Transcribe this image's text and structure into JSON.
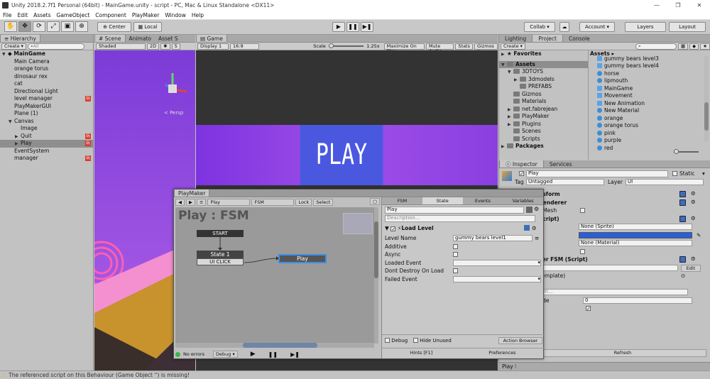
{
  "window": {
    "title": "Unity 2018.2.7f1 Personal (64bit) - MainGame.unity - script - PC, Mac & Linux Standalone <DX11>"
  },
  "menu": [
    "File",
    "Edit",
    "Assets",
    "GameObject",
    "Component",
    "PlayMaker",
    "Window",
    "Help"
  ],
  "toolbar": {
    "center": "Center",
    "local": "Local",
    "collab": "Collab ▾",
    "account": "Account ▾",
    "layers": "Layers",
    "layout": "Layout"
  },
  "hierarchy": {
    "tab": "Hierarchy",
    "create": "Create ▾",
    "search": "All",
    "scene": "MainGame",
    "items": [
      {
        "label": "Main Camera",
        "indent": 1,
        "arrow": "",
        "badge": false,
        "selected": false
      },
      {
        "label": "orange torus",
        "indent": 1,
        "arrow": "",
        "badge": false,
        "selected": false
      },
      {
        "label": "dinosaur rex",
        "indent": 1,
        "arrow": "",
        "badge": false,
        "selected": false
      },
      {
        "label": "cat",
        "indent": 1,
        "arrow": "",
        "badge": false,
        "selected": false
      },
      {
        "label": "Directional Light",
        "indent": 1,
        "arrow": "",
        "badge": false,
        "selected": false
      },
      {
        "label": "level manager",
        "indent": 1,
        "arrow": "",
        "badge": true,
        "selected": false
      },
      {
        "label": "PlayMakerGUI",
        "indent": 1,
        "arrow": "",
        "badge": false,
        "selected": false
      },
      {
        "label": "Plane (1)",
        "indent": 1,
        "arrow": "",
        "badge": false,
        "selected": false
      },
      {
        "label": "Canvas",
        "indent": 1,
        "arrow": "▼",
        "badge": false,
        "selected": false
      },
      {
        "label": "Image",
        "indent": 2,
        "arrow": "",
        "badge": false,
        "selected": false
      },
      {
        "label": "Quit",
        "indent": 2,
        "arrow": "▶",
        "badge": true,
        "selected": false
      },
      {
        "label": "Play",
        "indent": 2,
        "arrow": "▶",
        "badge": true,
        "selected": true
      },
      {
        "label": "EventSystem",
        "indent": 1,
        "arrow": "",
        "badge": false,
        "selected": false
      },
      {
        "label": "manager",
        "indent": 1,
        "arrow": "",
        "badge": true,
        "selected": false
      }
    ],
    "badge_text": "玩"
  },
  "scene": {
    "tabs": [
      "Scene",
      "Animato",
      "Asset S"
    ],
    "shaded": "Shaded",
    "mode2d": "2D",
    "persp": "< Persp"
  },
  "game": {
    "tab": "Game",
    "display": "Display 1",
    "aspect": "16:9",
    "scale_label": "Scale",
    "scale_value": "1.25x",
    "buttons": [
      "Maximize On Play",
      "Mute Audio",
      "Stats",
      "Gizmos ▾"
    ],
    "play_text": "PLAY"
  },
  "project": {
    "tabs": [
      "Lighting",
      "Project",
      "Console"
    ],
    "create": "Create ▾",
    "favorites": "Favorites",
    "tree": [
      {
        "label": "Assets",
        "indent": 0,
        "arrow": "▼",
        "selected": true
      },
      {
        "label": "3DTOYS",
        "indent": 1,
        "arrow": "▼",
        "selected": false
      },
      {
        "label": "3dmodels",
        "indent": 2,
        "arrow": "▶",
        "selected": false
      },
      {
        "label": "PREFABS",
        "indent": 2,
        "arrow": "",
        "selected": false
      },
      {
        "label": "Gizmos",
        "indent": 1,
        "arrow": "",
        "selected": false
      },
      {
        "label": "Materials",
        "indent": 1,
        "arrow": "",
        "selected": false
      },
      {
        "label": "net.fabrejean",
        "indent": 1,
        "arrow": "▶",
        "selected": false
      },
      {
        "label": "PlayMaker",
        "indent": 1,
        "arrow": "▶",
        "selected": false
      },
      {
        "label": "Plugins",
        "indent": 1,
        "arrow": "▶",
        "selected": false
      },
      {
        "label": "Scenes",
        "indent": 1,
        "arrow": "",
        "selected": false
      },
      {
        "label": "Scripts",
        "indent": 1,
        "arrow": "",
        "selected": false
      },
      {
        "label": "Packages",
        "indent": 0,
        "arrow": "▶",
        "selected": false
      }
    ],
    "assets_header": "Assets ▸",
    "assets": [
      {
        "label": "gummy bears level3",
        "icon": "prefab"
      },
      {
        "label": "gummy bears level4",
        "icon": "prefab"
      },
      {
        "label": "horse",
        "icon": "sphere"
      },
      {
        "label": "lipmouth",
        "icon": "sphere"
      },
      {
        "label": "MainGame",
        "icon": "prefab"
      },
      {
        "label": "Movement",
        "icon": "prefab"
      },
      {
        "label": "New Animation",
        "icon": "prefab"
      },
      {
        "label": "New Material",
        "icon": "sphere"
      },
      {
        "label": "orange",
        "icon": "sphere"
      },
      {
        "label": "orange torus",
        "icon": "sphere"
      },
      {
        "label": "pink",
        "icon": "sphere"
      },
      {
        "label": "purple",
        "icon": "sphere"
      },
      {
        "label": "red",
        "icon": "sphere"
      }
    ]
  },
  "inspector": {
    "tabs": [
      "Inspector",
      "Services"
    ],
    "object_name": "Play",
    "static_label": "Static",
    "tag_label": "Tag",
    "tag_value": "Untagged",
    "layer_label": "Layer",
    "layer_value": "UI",
    "sections": [
      "nsform",
      "Renderer",
      "t Mesh",
      "Script)",
      "ker FSM (Script)",
      "Template)"
    ],
    "sprite_value": "None (Sprite)",
    "material_value": "None (Material)",
    "edit_button": "Edit",
    "url_placeholder": "Url...",
    "ride_label": "ride",
    "ride_value": "0",
    "le_label": "le",
    "refresh_button": "Refresh",
    "footer_label": "Play"
  },
  "playmaker": {
    "tab": "PlayMaker",
    "object_select": "Play",
    "fsm_select": "FSM",
    "lock": "Lock",
    "select": "Select",
    "graph_title": "Play : FSM",
    "start_node": "START",
    "state1_node": "State 1",
    "state1_event": "UI CLICK",
    "play_node": "Play",
    "status": "No errors",
    "debug": "Debug ▾",
    "right_tabs": [
      "FSM",
      "State",
      "Events",
      "Variables"
    ],
    "state_name": "Play",
    "description_placeholder": "Description...",
    "action_title": "Load Level",
    "fields": [
      {
        "label": "Level Name",
        "value": "gummy bears level1",
        "type": "text"
      },
      {
        "label": "Additive",
        "value": "",
        "type": "check"
      },
      {
        "label": "Async",
        "value": "",
        "type": "check"
      },
      {
        "label": "Loaded Event",
        "value": "",
        "type": "select"
      },
      {
        "label": "Dont Destroy On Load",
        "value": "",
        "type": "check"
      },
      {
        "label": "Failed Event",
        "value": "",
        "type": "select"
      }
    ],
    "debug_check": "Debug",
    "hide_unused": "Hide Unused",
    "action_browser": "Action Browser",
    "hints": "Hints [F1]",
    "preferences": "Preferences"
  },
  "status_bar": {
    "message": "The referenced script on this Behaviour (Game Object '') is missing!"
  }
}
